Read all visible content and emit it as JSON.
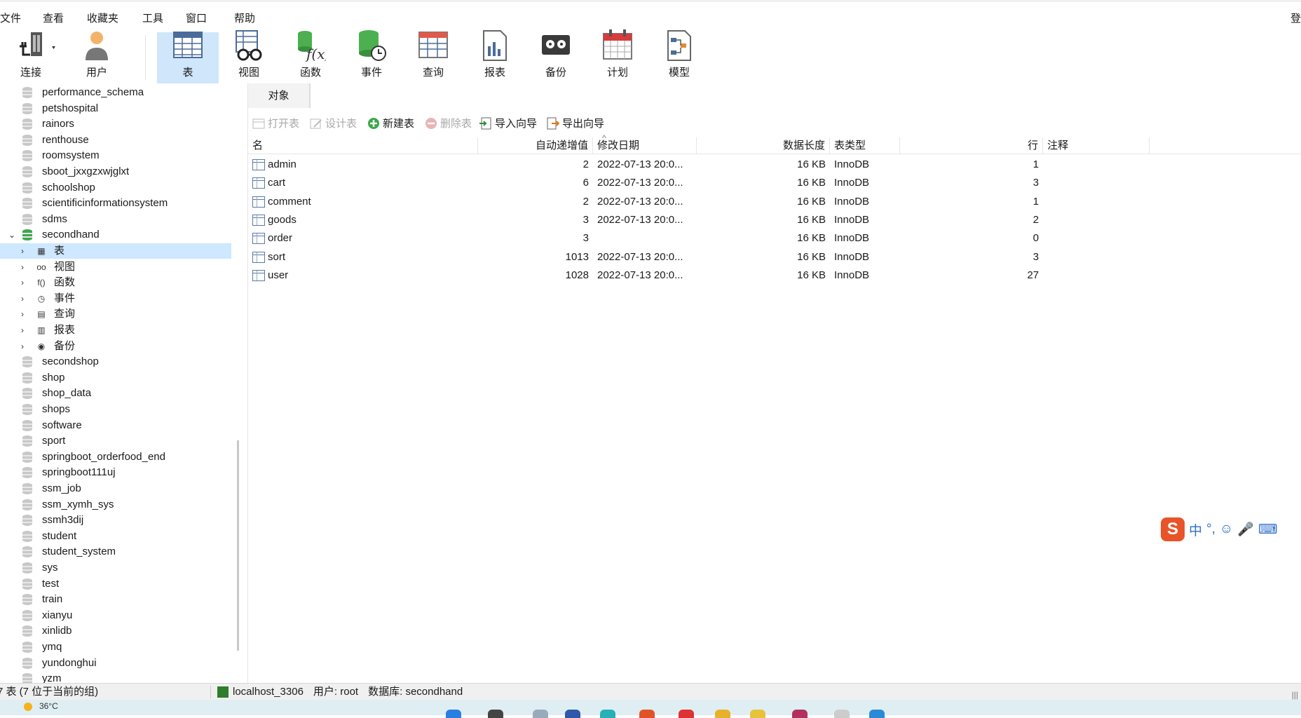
{
  "menu": {
    "items": [
      "文件",
      "查看",
      "收藏夹",
      "工具",
      "窗口",
      "帮助"
    ],
    "login": "登"
  },
  "toolbar": {
    "connect": "连接",
    "user": "用户",
    "table": "表",
    "view": "视图",
    "function": "函数",
    "event": "事件",
    "query": "查询",
    "report": "报表",
    "backup": "备份",
    "schedule": "计划",
    "model": "模型"
  },
  "tree": {
    "databases_before": [
      "performance_schema",
      "petshospital",
      "rainors",
      "renthouse",
      "roomsystem",
      "sboot_jxxgzxwjglxt",
      "schoolshop",
      "scientificinformationsystem",
      "sdms"
    ],
    "open_db": "secondhand",
    "children": [
      "表",
      "视图",
      "函数",
      "事件",
      "查询",
      "报表",
      "备份"
    ],
    "databases_after": [
      "secondshop",
      "shop",
      "shop_data",
      "shops",
      "software",
      "sport",
      "springboot_orderfood_end",
      "springboot111uj",
      "ssm_job",
      "ssm_xymh_sys",
      "ssmh3dij",
      "student",
      "student_system",
      "sys",
      "test",
      "train",
      "xianyu",
      "xinlidb",
      "ymq",
      "yundonghui",
      "yzm"
    ]
  },
  "objects": {
    "tab": "对象",
    "actions": {
      "open": "打开表",
      "design": "设计表",
      "new": "新建表",
      "delete": "删除表",
      "import": "导入向导",
      "export": "导出向导"
    },
    "columns": [
      "名",
      "自动递增值",
      "修改日期",
      "数据长度",
      "表类型",
      "行",
      "注释"
    ],
    "rows": [
      {
        "name": "admin",
        "ai": "2",
        "date": "2022-07-13 20:0...",
        "size": "16 KB",
        "type": "InnoDB",
        "rows": "1"
      },
      {
        "name": "cart",
        "ai": "6",
        "date": "2022-07-13 20:0...",
        "size": "16 KB",
        "type": "InnoDB",
        "rows": "3"
      },
      {
        "name": "comment",
        "ai": "2",
        "date": "2022-07-13 20:0...",
        "size": "16 KB",
        "type": "InnoDB",
        "rows": "1"
      },
      {
        "name": "goods",
        "ai": "3",
        "date": "2022-07-13 20:0...",
        "size": "16 KB",
        "type": "InnoDB",
        "rows": "2"
      },
      {
        "name": "order",
        "ai": "3",
        "date": "",
        "size": "16 KB",
        "type": "InnoDB",
        "rows": "0"
      },
      {
        "name": "sort",
        "ai": "1013",
        "date": "2022-07-13 20:0...",
        "size": "16 KB",
        "type": "InnoDB",
        "rows": "3"
      },
      {
        "name": "user",
        "ai": "1028",
        "date": "2022-07-13 20:0...",
        "size": "16 KB",
        "type": "InnoDB",
        "rows": "27"
      }
    ]
  },
  "ime": {
    "zh": "中",
    "punct": "°,"
  },
  "status": {
    "count": "7 表 (7 位于当前的组)",
    "connection": "localhost_3306",
    "user": "用户: root",
    "database": "数据库: secondhand"
  },
  "taskbar": {
    "weather": "36°C"
  },
  "colors": {
    "selected": "#cde8ff",
    "toolbar_active": "#cfe6fb",
    "db_open": "#3aa84a"
  }
}
